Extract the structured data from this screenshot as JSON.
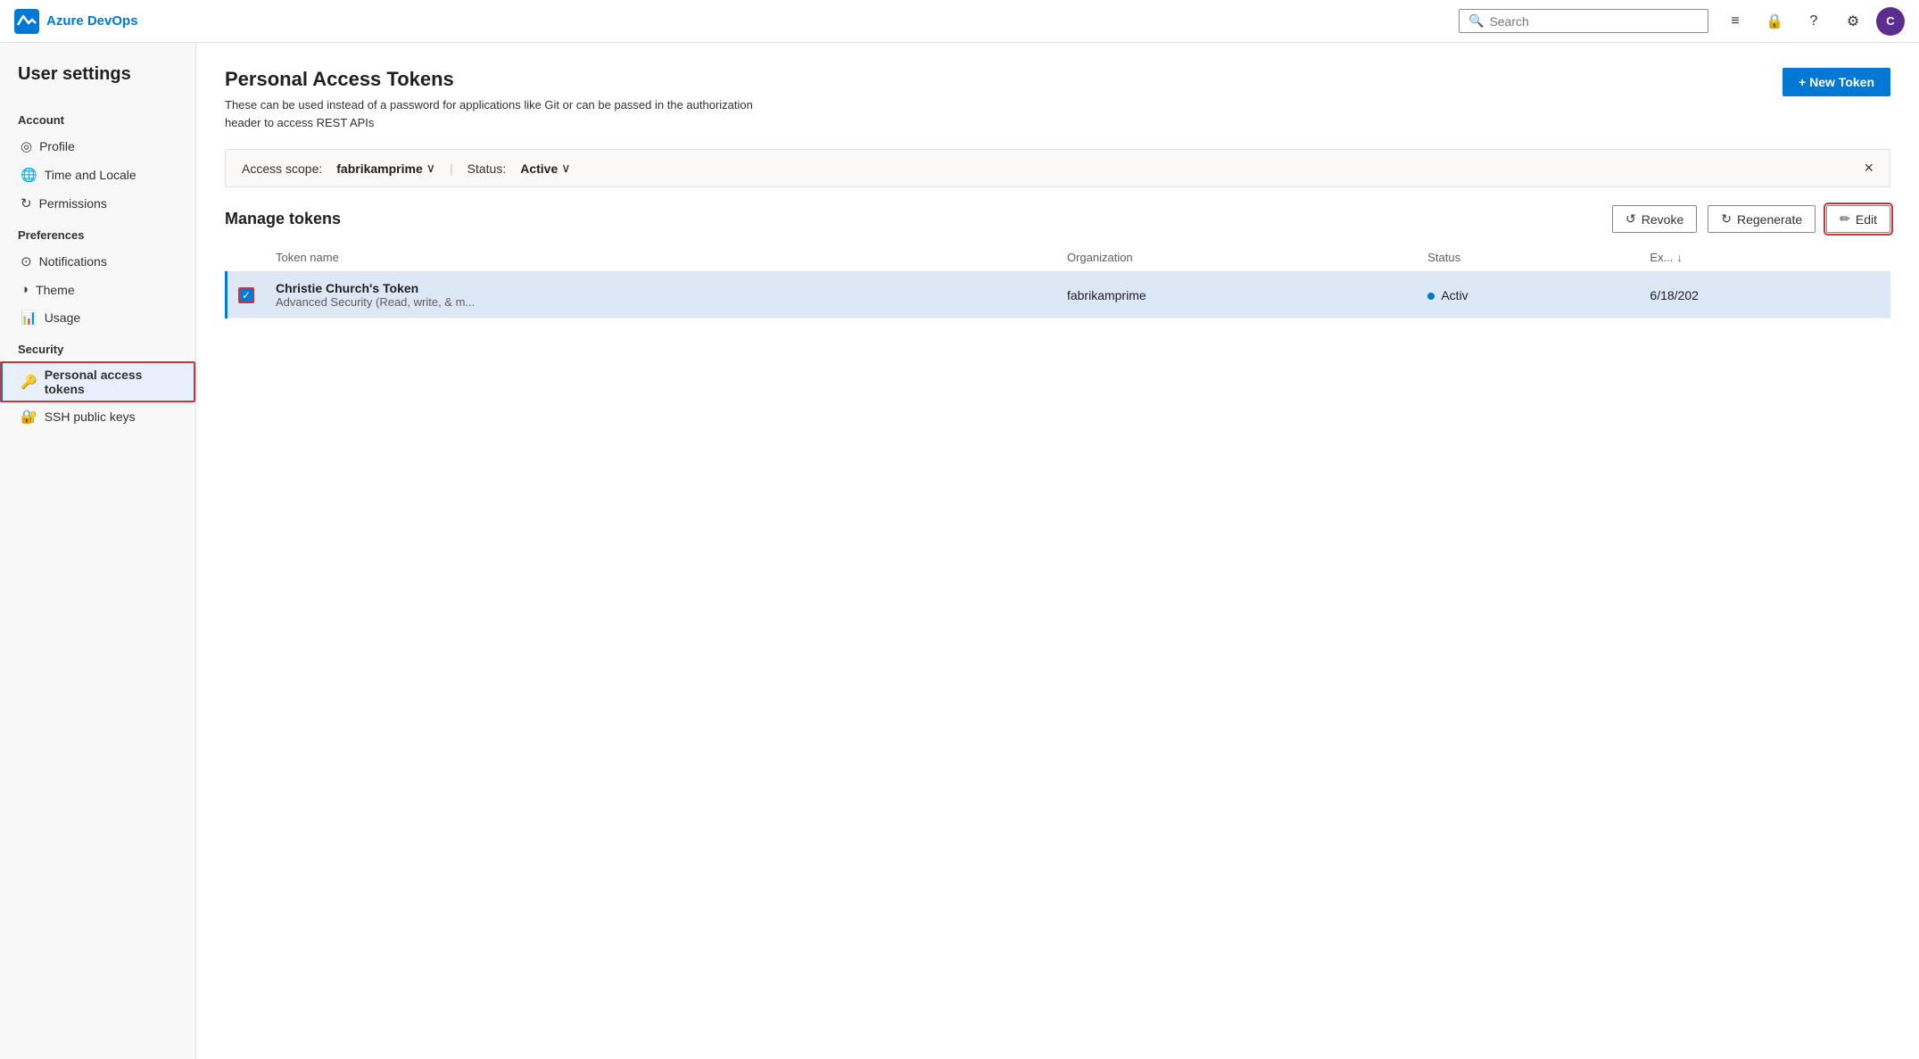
{
  "topnav": {
    "brand": "Azure DevOps",
    "search_placeholder": "Search",
    "icons": {
      "tasks": "☰",
      "lock": "🔒",
      "help": "?",
      "settings": "⚙"
    },
    "avatar_initials": "C"
  },
  "sidebar": {
    "title": "User settings",
    "sections": [
      {
        "label": "Account",
        "items": [
          {
            "id": "profile",
            "label": "Profile",
            "icon": "👤"
          },
          {
            "id": "time-locale",
            "label": "Time and Locale",
            "icon": "🌐"
          },
          {
            "id": "permissions",
            "label": "Permissions",
            "icon": "↻"
          }
        ]
      },
      {
        "label": "Preferences",
        "items": [
          {
            "id": "notifications",
            "label": "Notifications",
            "icon": "🔔"
          },
          {
            "id": "theme",
            "label": "Theme",
            "icon": "◑"
          },
          {
            "id": "usage",
            "label": "Usage",
            "icon": "📊"
          }
        ]
      },
      {
        "label": "Security",
        "items": [
          {
            "id": "personal-access-tokens",
            "label": "Personal access tokens",
            "icon": "🔑",
            "active": true
          },
          {
            "id": "ssh-public-keys",
            "label": "SSH public keys",
            "icon": "🔐"
          }
        ]
      }
    ]
  },
  "main": {
    "page_title": "Personal Access Tokens",
    "page_subtitle": "These can be used instead of a password for applications like Git or can be passed in the authorization header to access REST APIs",
    "new_token_button": "+ New Token",
    "filter": {
      "access_scope_label": "Access scope:",
      "access_scope_value": "fabrikamprime",
      "status_label": "Status:",
      "status_value": "Active"
    },
    "manage_tokens": {
      "title": "Manage tokens",
      "buttons": [
        {
          "id": "revoke",
          "label": "Revoke",
          "icon": "↺"
        },
        {
          "id": "regenerate",
          "label": "Regenerate",
          "icon": "↻"
        },
        {
          "id": "edit",
          "label": "Edit",
          "icon": "✏",
          "highlighted": true
        }
      ]
    },
    "table": {
      "columns": [
        {
          "id": "checkbox",
          "label": ""
        },
        {
          "id": "token-name",
          "label": "Token name"
        },
        {
          "id": "organization",
          "label": "Organization"
        },
        {
          "id": "status",
          "label": "Status"
        },
        {
          "id": "expiry",
          "label": "Ex...",
          "sortable": true
        }
      ],
      "rows": [
        {
          "id": "row-1",
          "selected": true,
          "token_name": "Christie Church's Token",
          "token_desc": "Advanced Security (Read, write, & m...",
          "organization": "fabrikamprime",
          "status": "Activ",
          "expiry": "6/18/202"
        }
      ]
    }
  }
}
